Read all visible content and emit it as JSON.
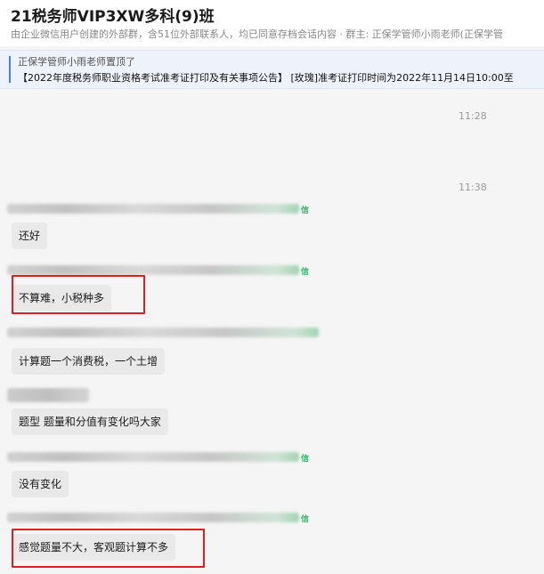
{
  "header": {
    "title": "21税务师VIP3XW多科(9)班",
    "subtitle": "由企业微信用户创建的外部群，含51位外部联系人，均已同意存档会话内容 · 群主: 正保学管师小雨老师(正保学管"
  },
  "pinned": {
    "by": "正保学管师小雨老师置顶了",
    "text": "【2022年度税务师职业资格考试准考证打印及有关事项公告】 [玫瑰]准考证打印时间为2022年11月14日10:00至"
  },
  "timestamps": [
    "11:28",
    "11:38"
  ],
  "wechat_tag": "信",
  "messages": [
    {
      "text": "还好"
    },
    {
      "text": "不算难，小税种多"
    },
    {
      "text": "计算题一个消费税，一个土增"
    },
    {
      "text": "题型 题量和分值有变化吗大家"
    },
    {
      "text": "没有变化"
    },
    {
      "text": "感觉题量不大，客观题计算不多"
    }
  ]
}
